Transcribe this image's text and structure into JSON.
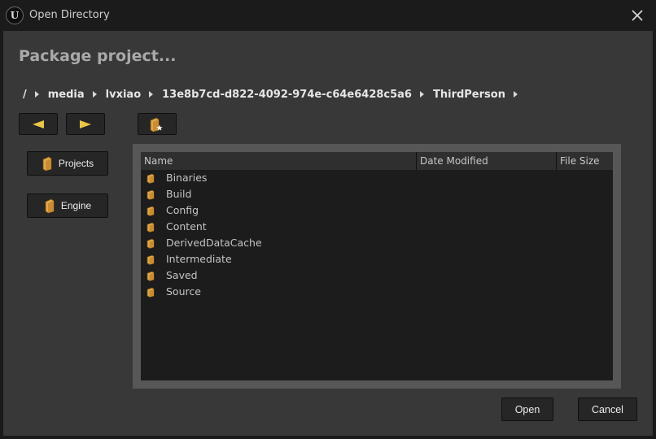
{
  "window": {
    "title": "Open Directory",
    "heading": "Package project..."
  },
  "breadcrumb": [
    "/",
    "media",
    "lvxiao",
    "13e8b7cd-d822-4092-974e-c64e6428c5a6",
    "ThirdPerson"
  ],
  "sidebar": {
    "projects_label": "Projects",
    "engine_label": "Engine"
  },
  "columns": {
    "name": "Name",
    "date_modified": "Date Modified",
    "file_size": "File Size"
  },
  "folders": [
    {
      "name": "Binaries",
      "date_modified": "",
      "file_size": ""
    },
    {
      "name": "Build",
      "date_modified": "",
      "file_size": ""
    },
    {
      "name": "Config",
      "date_modified": "",
      "file_size": ""
    },
    {
      "name": "Content",
      "date_modified": "",
      "file_size": ""
    },
    {
      "name": "DerivedDataCache",
      "date_modified": "",
      "file_size": ""
    },
    {
      "name": "Intermediate",
      "date_modified": "",
      "file_size": ""
    },
    {
      "name": "Saved",
      "date_modified": "",
      "file_size": ""
    },
    {
      "name": "Source",
      "date_modified": "",
      "file_size": ""
    }
  ],
  "buttons": {
    "open": "Open",
    "cancel": "Cancel"
  },
  "icons": {
    "back": "arrow-left-icon",
    "forward": "arrow-right-icon",
    "new_folder": "new-folder-icon",
    "folder": "folder-icon",
    "close": "close-icon",
    "app": "unreal-logo"
  },
  "colors": {
    "accent": "#e9c64a",
    "folder": "#e1a84a",
    "background": "#383838",
    "list_background": "#1c1c1c"
  }
}
